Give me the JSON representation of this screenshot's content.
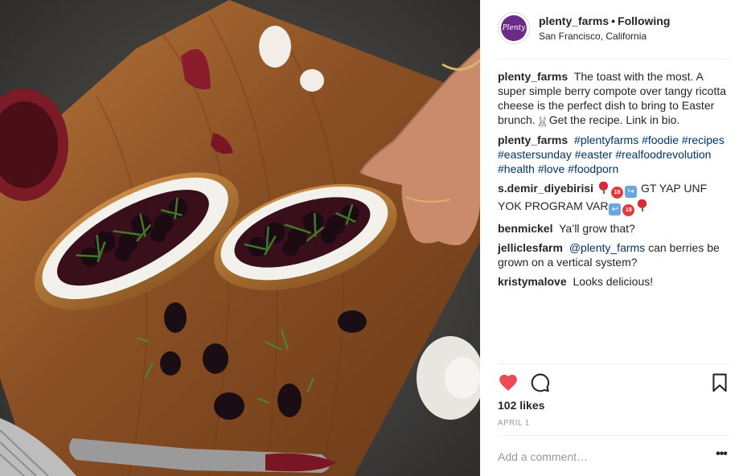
{
  "post": {
    "image_alt": "Berry compote toast on wooden board",
    "header": {
      "username": "plenty_farms",
      "separator": "•",
      "follow_label": "Following",
      "location": "San Francisco, California",
      "avatar_text": "Plenty"
    },
    "comments": [
      {
        "user": "plenty_farms",
        "text": "The toast with the most. A super simple berry compote over tangy ricotta cheese is the perfect dish to bring to Easter brunch.",
        "emoji_after": "bunny",
        "text2": "Get the recipe. Link in bio."
      },
      {
        "user": "plenty_farms",
        "tags": "#plentyfarms #foodie #recipes #eastersunday #easter #realfoodrevolution #health #love #foodporn"
      },
      {
        "user": "s.demir_diyebirisi",
        "text_a": "GT YAP UNF YOK PROGRAM VAR"
      },
      {
        "user": "benmickel",
        "text": "Ya’ll grow that?"
      },
      {
        "user": "jelliclesfarm",
        "mention": "@plenty_farms",
        "text": " can berries be grown on a vertical system?"
      },
      {
        "user": "kristymalove",
        "text": "Looks delicious!"
      }
    ],
    "actions": {
      "like_icon": "heart-icon",
      "comment_icon": "speech-bubble-icon",
      "save_icon": "bookmark-icon",
      "liked": true,
      "like_color": "#ed4956"
    },
    "likes": "102 likes",
    "date": "APRIL 1",
    "add_comment_placeholder": "Add a comment…",
    "more_label": "•••"
  }
}
